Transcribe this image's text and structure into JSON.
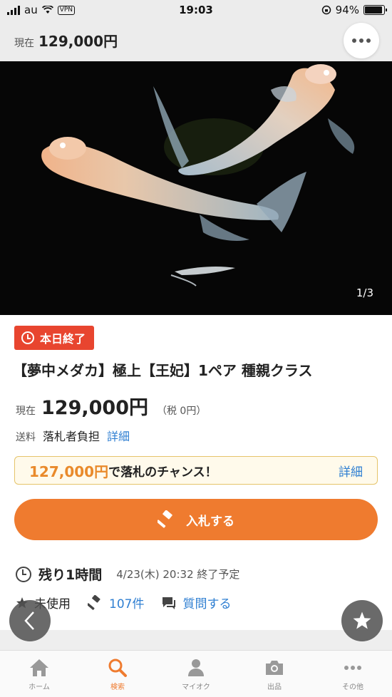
{
  "status_bar": {
    "carrier": "au",
    "vpn": "VPN",
    "time": "19:03",
    "battery": "94%"
  },
  "header": {
    "price_label": "現在",
    "price_value": "129,000円"
  },
  "photo": {
    "counter": "1/3"
  },
  "listing": {
    "end_tag": "本日終了",
    "title": "【夢中メダカ】極上【王妃】1ペア 種親クラス",
    "price_label": "現在",
    "price_value": "129,000円",
    "tax": "（税 0円）",
    "shipping_label": "送料",
    "shipping_value": "落札者負担",
    "shipping_detail": "詳細"
  },
  "chance": {
    "amount": "127,000円",
    "text": "で落札のチャンス！",
    "detail": "詳細"
  },
  "bid_button": {
    "label": "入札する"
  },
  "remaining": {
    "label": "残り1時間",
    "end_time": "4/23(木) 20:32 終了予定"
  },
  "meta": {
    "condition": "未使用",
    "bids": "107件",
    "question": "質問する"
  },
  "tabs": [
    {
      "label": "ホーム",
      "icon": "home-icon"
    },
    {
      "label": "検索",
      "icon": "search-icon",
      "active": true
    },
    {
      "label": "マイオク",
      "icon": "person-icon"
    },
    {
      "label": "出品",
      "icon": "camera-icon"
    },
    {
      "label": "その他",
      "icon": "more-icon"
    }
  ],
  "colors": {
    "accent": "#ef7b2f",
    "end_tag": "#e8452f",
    "link": "#2f7fd2"
  }
}
